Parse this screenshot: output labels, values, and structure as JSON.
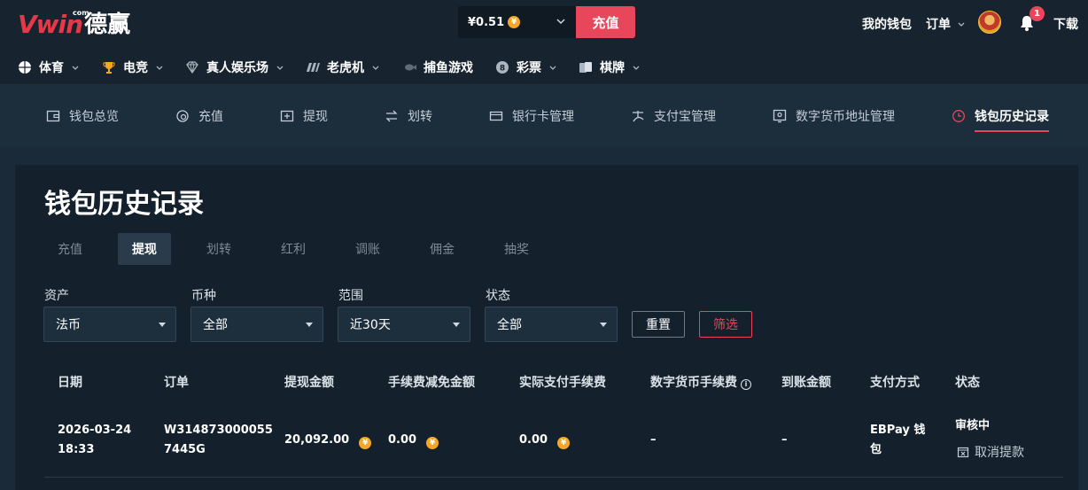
{
  "header": {
    "logo_text": "Vwin",
    "logo_com": "com",
    "logo_cn": "德赢",
    "balance": "¥0.51",
    "currency_symbol": "¥",
    "deposit_label": "充值",
    "wallet_label": "我的钱包",
    "orders_label": "订单",
    "notification_count": "1",
    "download_label": "下载"
  },
  "nav": {
    "items": [
      {
        "label": "体育",
        "icon": "basketball-icon"
      },
      {
        "label": "电竞",
        "icon": "trophy-icon"
      },
      {
        "label": "真人娱乐场",
        "icon": "diamond-icon"
      },
      {
        "label": "老虎机",
        "icon": "slot-icon"
      },
      {
        "label": "捕鱼游戏",
        "icon": "fish-icon"
      },
      {
        "label": "彩票",
        "icon": "lottery-ball-icon"
      },
      {
        "label": "棋牌",
        "icon": "cards-icon"
      }
    ]
  },
  "wallet_nav": {
    "items": [
      {
        "label": "钱包总览",
        "icon": "wallet-icon"
      },
      {
        "label": "充值",
        "icon": "deposit-icon"
      },
      {
        "label": "提现",
        "icon": "withdraw-icon"
      },
      {
        "label": "划转",
        "icon": "transfer-icon"
      },
      {
        "label": "银行卡管理",
        "icon": "bank-card-icon"
      },
      {
        "label": "支付宝管理",
        "icon": "alipay-icon"
      },
      {
        "label": "数字货币地址管理",
        "icon": "crypto-address-icon"
      },
      {
        "label": "钱包历史记录",
        "icon": "clock-icon"
      }
    ],
    "active_index": 7
  },
  "page": {
    "title": "钱包历史记录",
    "tabs": [
      "充值",
      "提现",
      "划转",
      "红利",
      "调账",
      "佣金",
      "抽奖"
    ],
    "active_tab": "提现"
  },
  "filters": {
    "asset": {
      "label": "资产",
      "value": "法币"
    },
    "currency": {
      "label": "币种",
      "value": "全部"
    },
    "range": {
      "label": "范围",
      "value": "近30天"
    },
    "status": {
      "label": "状态",
      "value": "全部"
    },
    "reset_label": "重置",
    "filter_label": "筛选"
  },
  "table": {
    "columns": [
      "日期",
      "订单",
      "提现金额",
      "手续费减免金额",
      "实际支付手续费",
      "数字货币手续费",
      "到账金额",
      "支付方式",
      "状态"
    ],
    "rows": [
      {
        "date": "2026-03-24",
        "time": "18:33",
        "order_line1": "W314873000055",
        "order_line2": "7445G",
        "amount": "20,092.00",
        "fee_discount": "0.00",
        "actual_fee": "0.00",
        "crypto_fee": "–",
        "received": "–",
        "method_line1": "EBPay 钱",
        "method_line2": "包",
        "status": "审核中",
        "cancel_label": "取消提款"
      }
    ]
  },
  "colors": {
    "accent": "#e8475b",
    "coin": "#f5a623"
  }
}
